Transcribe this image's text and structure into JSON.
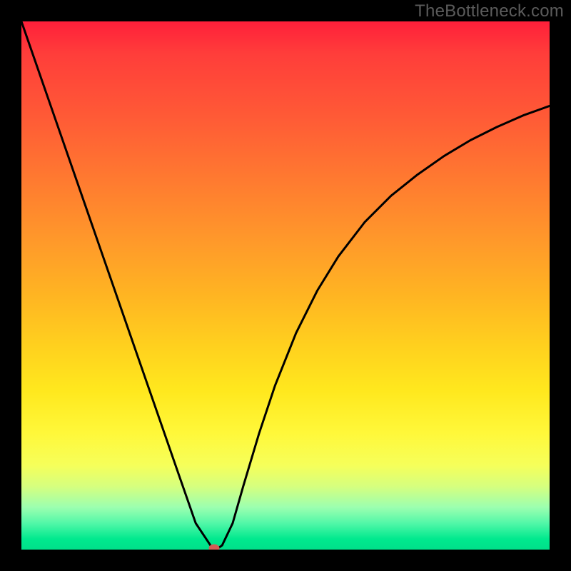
{
  "watermark": "TheBottleneck.com",
  "chart_data": {
    "type": "line",
    "title": "",
    "xlabel": "",
    "ylabel": "",
    "xlim": [
      0,
      100
    ],
    "ylim": [
      0,
      100
    ],
    "grid": false,
    "legend": false,
    "x": [
      0,
      5,
      10,
      15,
      20,
      25,
      30,
      33,
      35,
      36,
      37,
      38,
      40,
      42,
      45,
      48,
      52,
      56,
      60,
      65,
      70,
      75,
      80,
      85,
      90,
      95,
      100
    ],
    "y": [
      100,
      85.6,
      71.2,
      56.8,
      42.4,
      28.0,
      13.6,
      5.0,
      2.0,
      0.5,
      0.1,
      0.8,
      5.0,
      12.0,
      22.0,
      31.0,
      41.0,
      49.0,
      55.5,
      62.0,
      67.0,
      71.0,
      74.5,
      77.5,
      80.0,
      82.2,
      84.0
    ],
    "marker": {
      "x": 36.5,
      "y": 0.3,
      "color": "#d55b55"
    },
    "colors": {
      "curve": "#000000",
      "background_gradient_top": "#ff1f3a",
      "background_gradient_bottom": "#00e08a"
    }
  }
}
